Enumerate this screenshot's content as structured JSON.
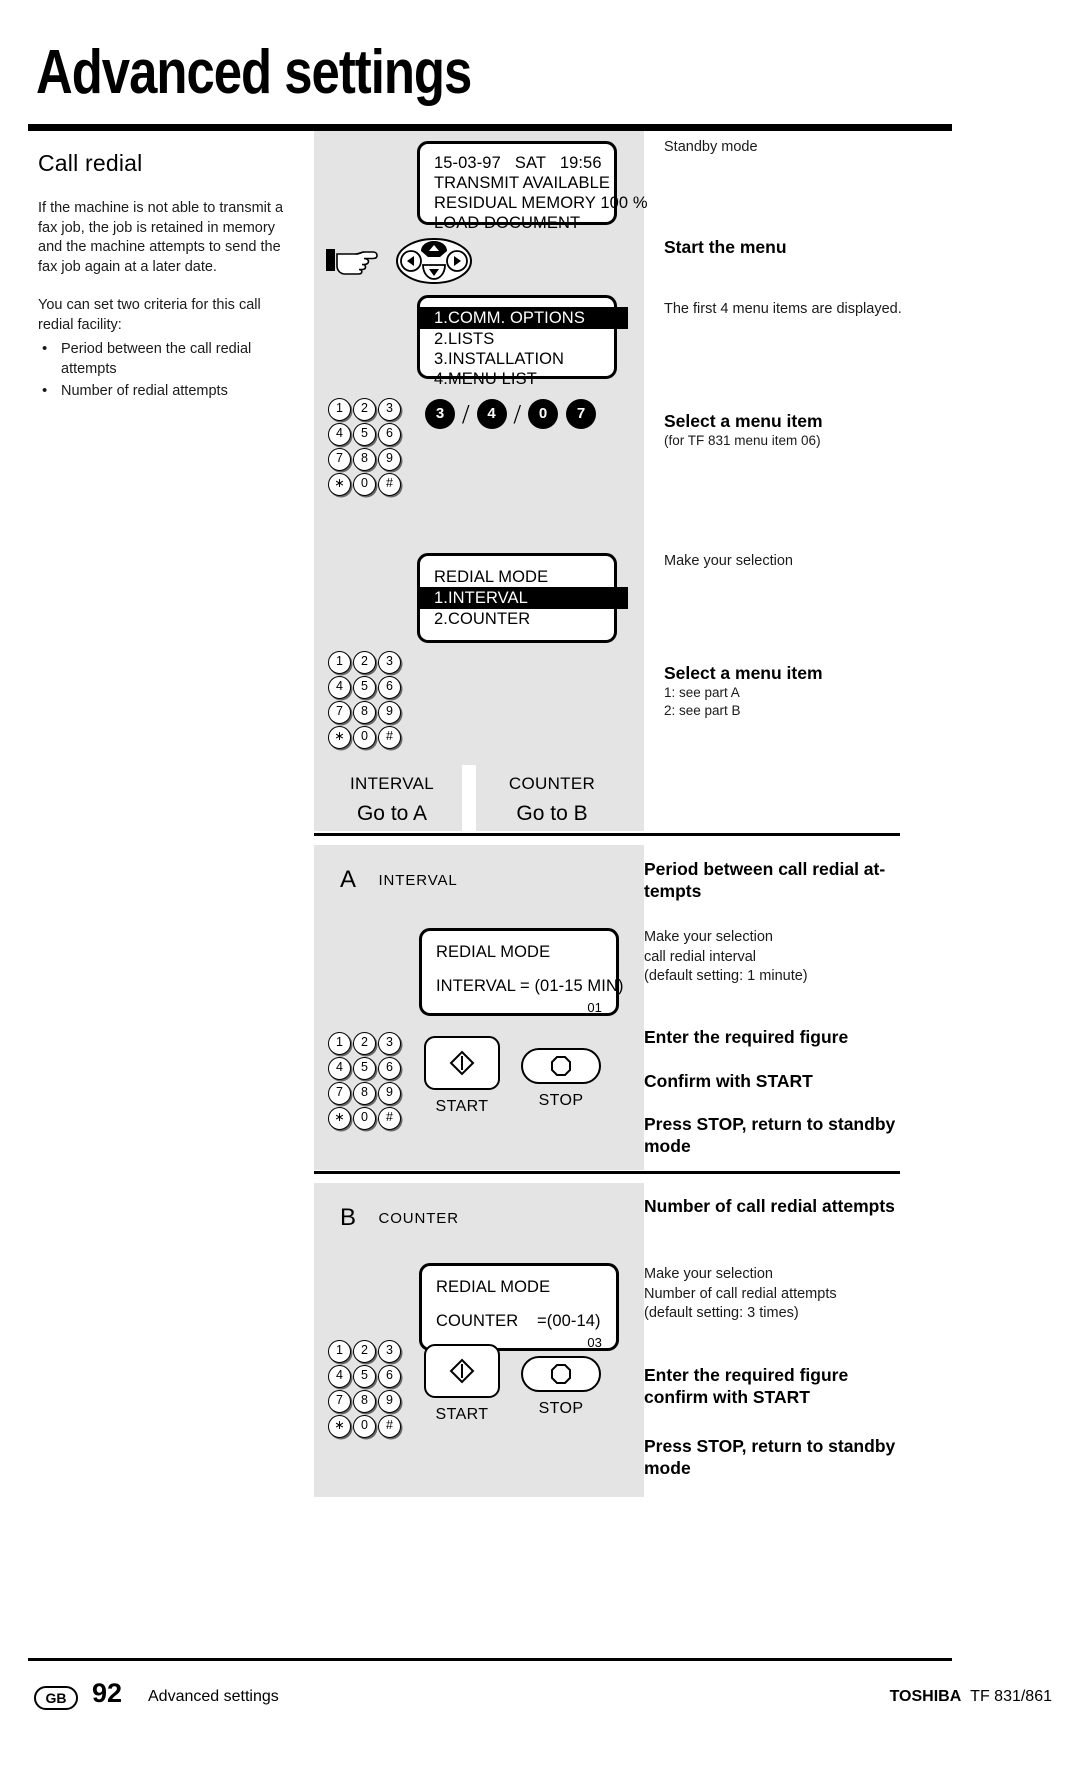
{
  "header": {
    "title": "Advanced settings"
  },
  "left": {
    "section_heading": "Call  redial",
    "paragraph1": "If the machine is not able to transmit a fax job, the job is retained in memory and the machine attempts to send the fax job again at a later date.",
    "paragraph2": "You can set two criteria for this call redial facility:",
    "bullets": [
      "Period between the call redial attempts",
      "Number of redial attempts"
    ]
  },
  "displays": {
    "standby": {
      "line1": "15-03-97   SAT   19:56",
      "line2": "TRANSMIT AVAILABLE",
      "line3": "RESIDUAL MEMORY 100 %",
      "line4": "LOAD DOCUMENT"
    },
    "menu": {
      "line1": "1.COMM. OPTIONS",
      "line2": "2.LISTS",
      "line3": "3.INSTALLATION",
      "line4": "4.MENU LIST"
    },
    "redial_mode": {
      "title": "REDIAL MODE",
      "line1": "1.INTERVAL",
      "line2": "2.COUNTER"
    },
    "interval": {
      "title": "REDIAL MODE",
      "value_line": "INTERVAL = (01-15 MIN)",
      "current": "01"
    },
    "counter": {
      "title": "REDIAL MODE",
      "value_line": "COUNTER    =(00-14)",
      "current": "03"
    }
  },
  "keycodes": {
    "d1": "3",
    "d2": "4",
    "d3": "0",
    "d4": "7"
  },
  "keypad": {
    "keys": [
      "1",
      "2",
      "3",
      "4",
      "5",
      "6",
      "7",
      "8",
      "9",
      "∗",
      "0",
      "#"
    ]
  },
  "split": {
    "left_title": "INTERVAL",
    "left_goto": "Go to A",
    "right_title": "COUNTER",
    "right_goto": "Go to B"
  },
  "tabs": {
    "a_letter": "A",
    "a_label": "INTERVAL",
    "b_letter": "B",
    "b_label": "COUNTER"
  },
  "buttons": {
    "start": "START",
    "stop": "STOP"
  },
  "annotations": {
    "standby_mode": "Standby mode",
    "start_the_menu": "Start the menu",
    "first_four": "The first 4 menu items are displayed.",
    "select_item_1_head": "Select a menu item",
    "select_item_1_sub": "(for TF 831 menu item 06)",
    "make_selection_1": "Make your selection",
    "select_item_2_head": "Select a menu item",
    "select_item_2_l1": "1: see part A",
    "select_item_2_l2": "2: see part B",
    "period_head_l1": "Period between call redial at-",
    "period_head_l2": "tempts",
    "a_make_l1": "Make your selection",
    "a_make_l2": "call redial interval",
    "a_make_l3": "(default setting: 1 minute)",
    "a_enter": "Enter the required figure",
    "a_confirm": "Confirm with START",
    "a_stop_l1": "Press STOP, return to standby",
    "a_stop_l2": "mode",
    "number_head": "Number of call redial attempts",
    "b_make_l1": "Make your selection",
    "b_make_l2": "Number of call redial attempts",
    "b_make_l3": "(default setting: 3 times)",
    "b_enter_l1": "Enter the required figure",
    "b_enter_l2": "confirm with START",
    "b_stop_l1": "Press STOP, return to standby",
    "b_stop_l2": "mode"
  },
  "footer": {
    "locale": "GB",
    "page_number": "92",
    "section": "Advanced settings",
    "brand": "TOSHIBA",
    "model": "TF 831/861"
  },
  "colors": {
    "panel_grey": "#e4e4e4",
    "ink": "#000000",
    "page": "#ffffff"
  }
}
